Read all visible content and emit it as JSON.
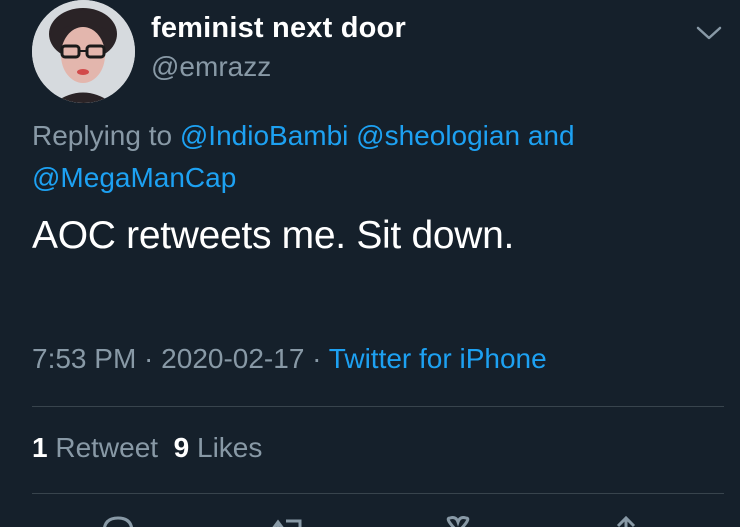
{
  "author": {
    "display_name": "feminist next door",
    "handle": "@emrazz"
  },
  "reply": {
    "prefix": "Replying to ",
    "mention_1": "@IndioBambi",
    "mention_2": "@sheologian",
    "conjunction": " and",
    "mention_3": "@MegaManCap"
  },
  "tweet": {
    "text": "AOC retweets me. Sit down."
  },
  "meta": {
    "time": "7:53 PM",
    "date": "2020-02-17",
    "separator": " · ",
    "source": "Twitter for iPhone"
  },
  "stats": {
    "retweet_count": "1",
    "retweet_label": "Retweet",
    "like_count": "9",
    "like_label": "Likes"
  },
  "icons": {
    "menu": "chevron-down-icon",
    "reply": "reply-icon",
    "retweet": "retweet-icon",
    "like": "heart-icon",
    "share": "share-icon"
  },
  "colors": {
    "background": "#15202b",
    "link": "#1da1f2",
    "secondary_text": "#8899a6",
    "divider": "#38444d"
  }
}
